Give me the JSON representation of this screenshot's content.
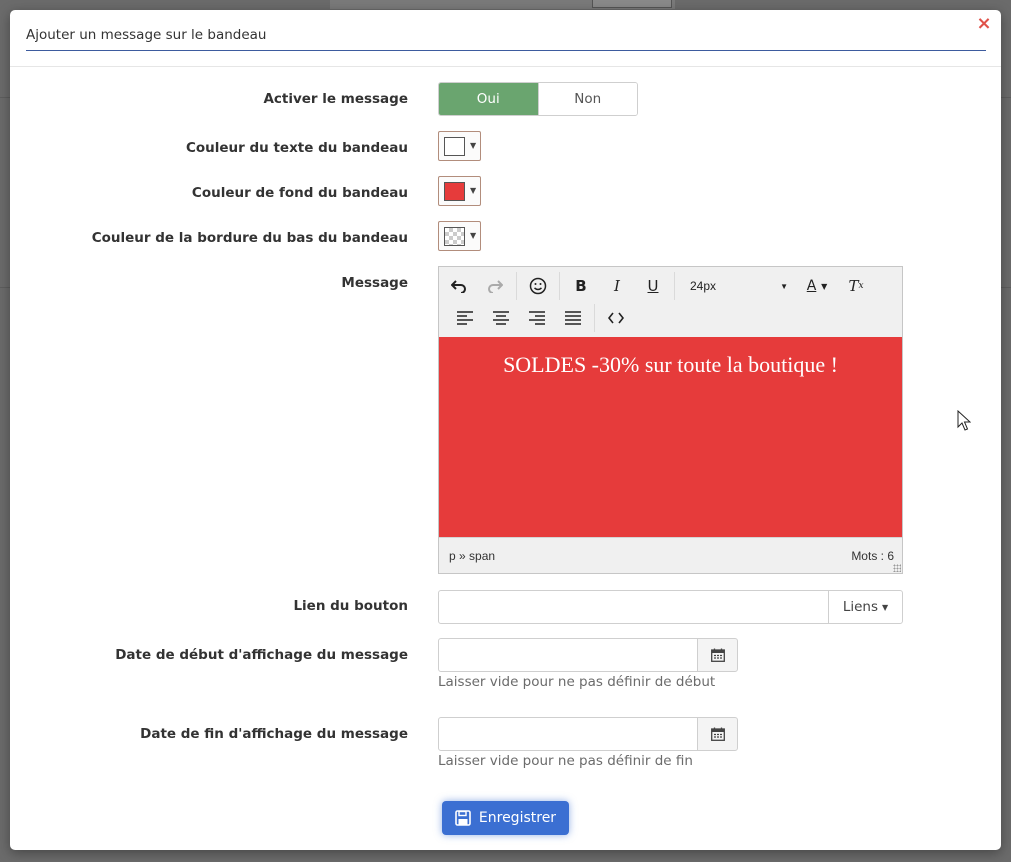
{
  "modal": {
    "title": "Ajouter un message sur le bandeau",
    "close_icon": "×"
  },
  "fields": {
    "activate": {
      "label": "Activer le message",
      "on_label": "Oui",
      "off_label": "Non",
      "selected": "Oui"
    },
    "text_color": {
      "label": "Couleur du texte du bandeau",
      "value": "#ffffff"
    },
    "bg_color": {
      "label": "Couleur de fond du bandeau",
      "value": "#e63b3b"
    },
    "border_color": {
      "label": "Couleur de la bordure du bas du bandeau",
      "value": "transparent"
    },
    "message": {
      "label": "Message",
      "content": "SOLDES -30% sur toute la boutique !",
      "font_size": "24px",
      "path": "p » span",
      "word_count": "Mots : 6"
    },
    "button_link": {
      "label": "Lien du bouton",
      "value": "",
      "addon_label": "Liens"
    },
    "start_date": {
      "label": "Date de début d'affichage du message",
      "value": "",
      "help": "Laisser vide pour ne pas définir de début"
    },
    "end_date": {
      "label": "Date de fin d'affichage du message",
      "value": "",
      "help": "Laisser vide pour ne pas définir de fin"
    }
  },
  "toolbar": {
    "row1": [
      "undo-icon",
      "redo-icon",
      "emoticons-icon",
      "bold-icon",
      "italic-icon",
      "underline-icon",
      "font-size-select",
      "text-color-icon",
      "clear-format-icon"
    ],
    "row2": [
      "align-left-icon",
      "align-center-icon",
      "align-right-icon",
      "align-justify-icon",
      "source-code-icon"
    ]
  },
  "actions": {
    "save_label": "Enregistrer"
  },
  "colors": {
    "toggle_on": "#6aa56f",
    "primary": "#3b6fd2",
    "banner_bg": "#e63b3b",
    "close": "#e0524a"
  }
}
